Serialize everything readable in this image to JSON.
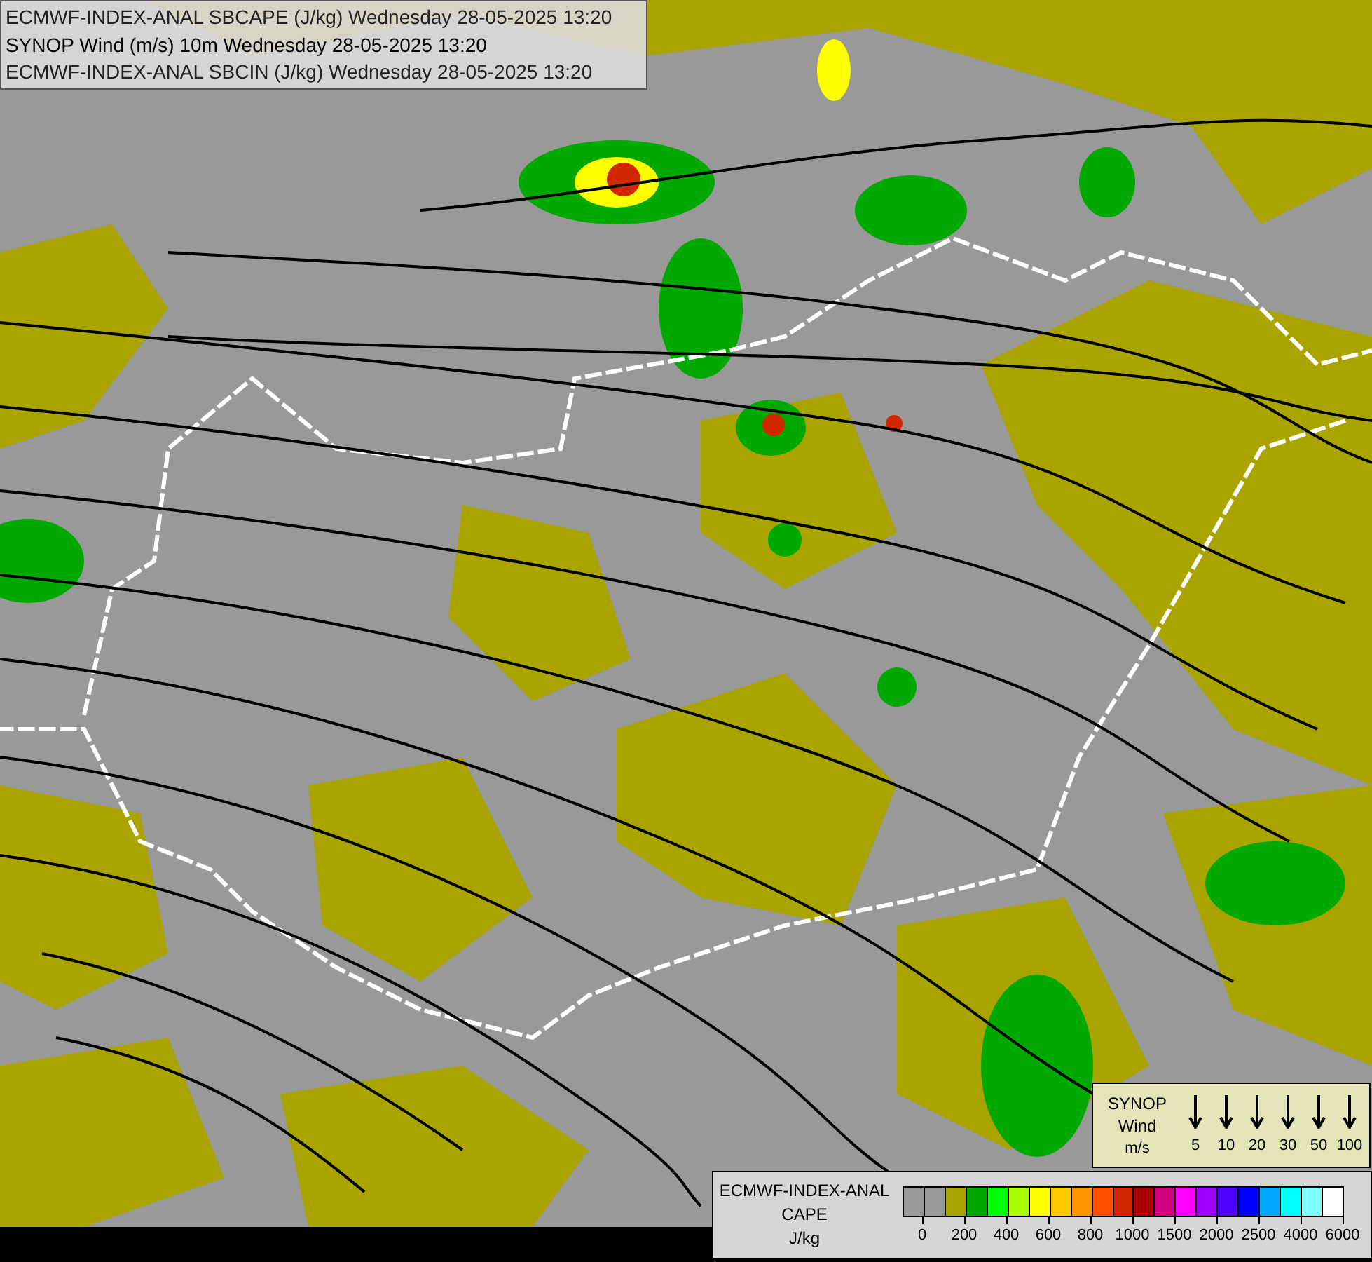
{
  "title_lines": [
    "ECMWF-INDEX-ANAL SBCAPE (J/kg) Wednesday 28-05-2025 13:20",
    "SYNOP Wind (m/s) 10m Wednesday 28-05-2025 13:20",
    "ECMWF-INDEX-ANAL SBCIN (J/kg) Wednesday 28-05-2025 13:20"
  ],
  "wind_legend": {
    "title_lines": [
      "SYNOP",
      "Wind",
      "m/s"
    ],
    "speeds": [
      "5",
      "10",
      "20",
      "30",
      "50",
      "100"
    ]
  },
  "cape_legend": {
    "title_lines": [
      "ECMWF-INDEX-ANAL",
      "CAPE",
      "J/kg"
    ],
    "swatches": [
      {
        "color": "#999999"
      },
      {
        "color": "#999999"
      },
      {
        "color": "#aaa400"
      },
      {
        "color": "#00a800"
      },
      {
        "color": "#00ff00"
      },
      {
        "color": "#aaff00"
      },
      {
        "color": "#ffff00"
      },
      {
        "color": "#ffc800"
      },
      {
        "color": "#ff9600"
      },
      {
        "color": "#ff5000"
      },
      {
        "color": "#d22800"
      },
      {
        "color": "#aa0000"
      },
      {
        "color": "#d20082"
      },
      {
        "color": "#ff00ff"
      },
      {
        "color": "#a000ff"
      },
      {
        "color": "#5000ff"
      },
      {
        "color": "#0000ff"
      },
      {
        "color": "#00aaff"
      },
      {
        "color": "#00ffff"
      },
      {
        "color": "#80ffff"
      },
      {
        "color": "#ffffff"
      }
    ],
    "ticks": [
      "0",
      "200",
      "400",
      "600",
      "800",
      "1000",
      "1500",
      "2000",
      "2500",
      "4000",
      "6000"
    ]
  }
}
